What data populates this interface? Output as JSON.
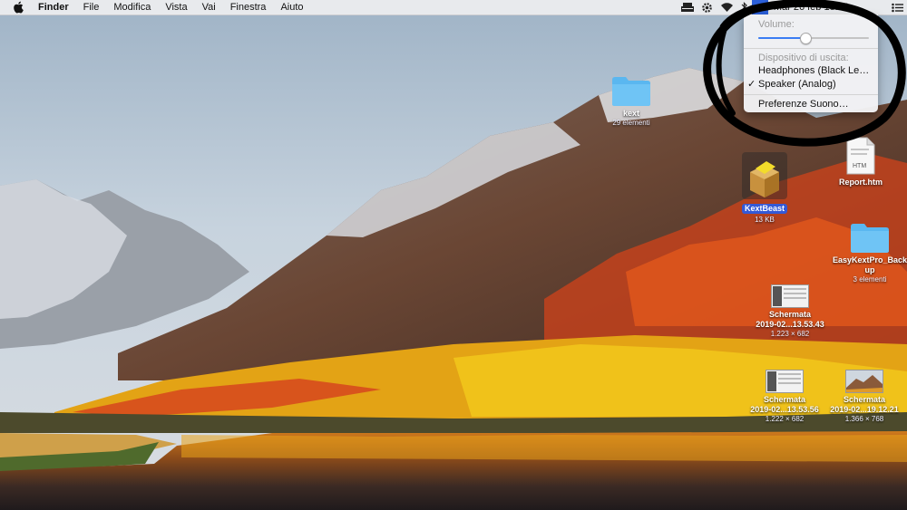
{
  "menubar": {
    "apple_icon": "apple-logo-icon",
    "app_name": "Finder",
    "menus": [
      "File",
      "Modifica",
      "Vista",
      "Vai",
      "Finestra",
      "Aiuto"
    ],
    "status_icons": [
      "keychain-icon",
      "gear-sync-icon",
      "wifi-icon",
      "volume-icon"
    ],
    "clock_text": "Mar 26 feb 18:18",
    "list_icon": "control-strip-list-icon"
  },
  "volume_menu": {
    "volume_header": "Volume:",
    "volume_level_percent": 43,
    "output_header": "Dispositivo di uscita:",
    "devices": [
      {
        "label": "Headphones (Black Le…",
        "checked": false
      },
      {
        "label": "Speaker (Analog)",
        "checked": true
      }
    ],
    "check_mark": "✓",
    "preferences_label": "Preferenze Suono…"
  },
  "desktop_icons": {
    "kext": {
      "label": "kext",
      "sub": "29 elementi",
      "icon": "folder-icon"
    },
    "report": {
      "label": "Report.htm",
      "badge": "HTM",
      "icon": "html-document-icon"
    },
    "kextbeast": {
      "label": "KextBeast",
      "sub": "13 KB",
      "icon": "installer-package-icon"
    },
    "easykextpro": {
      "label": "EasyKextPro_Back",
      "label2": "up",
      "sub": "3 elementi",
      "icon": "folder-icon"
    },
    "screenshot1": {
      "label": "Schermata",
      "label2": "2019-02...13.53.43",
      "sub": "1.223 × 682",
      "icon": "screenshot-thumbnail-icon"
    },
    "screenshot2": {
      "label": "Schermata",
      "label2": "2019-02...13.53.56",
      "sub": "1.222 × 682",
      "icon": "screenshot-thumbnail-icon"
    },
    "screenshot3": {
      "label": "Schermata",
      "label2": "2019-02...19.12.21",
      "sub": "1.366 × 768",
      "icon": "screenshot-thumbnail-icon"
    }
  },
  "colors": {
    "menubar_bg": "#eeeef0",
    "selection_blue": "#3459d6",
    "folder_blue": "#5ab7f0",
    "annotation_black": "#000000"
  }
}
